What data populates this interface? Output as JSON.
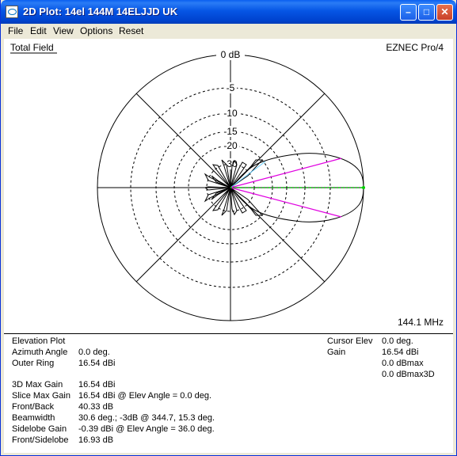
{
  "window": {
    "title": "2D Plot: 14el 144M  14ELJJD UK"
  },
  "menu": [
    "File",
    "Edit",
    "View",
    "Options",
    "Reset"
  ],
  "plot": {
    "field_label": "Total Field",
    "program_label": "EZNEC Pro/4",
    "frequency": "144.1 MHz",
    "ring_labels": [
      "0 dB",
      "-5",
      "-10",
      "-15",
      "-20",
      "-30"
    ],
    "colors": {
      "pattern": "#000000",
      "gain_marker": "#00CC00",
      "beamwidth_lines": "#E000E0",
      "sidelobe_line": "#66CCFF"
    }
  },
  "info": {
    "plot_type": "Elevation Plot",
    "rows_left": [
      {
        "label": "Azimuth Angle",
        "value": "0.0 deg."
      },
      {
        "label": "Outer Ring",
        "value": "16.54 dBi"
      },
      {
        "label": "3D Max Gain",
        "value": "16.54 dBi"
      },
      {
        "label": "Slice Max Gain",
        "value": "16.54 dBi @ Elev Angle = 0.0 deg."
      },
      {
        "label": "Front/Back",
        "value": "40.33 dB"
      },
      {
        "label": "Beamwidth",
        "value": "30.6 deg.; -3dB @ 344.7, 15.3 deg."
      },
      {
        "label": "Sidelobe Gain",
        "value": "-0.39 dBi @ Elev Angle = 36.0 deg."
      },
      {
        "label": "Front/Sidelobe",
        "value": "16.93 dB"
      }
    ],
    "cursor": {
      "elev_label": "Cursor Elev",
      "elev_value": "0.0 deg.",
      "gain_label": "Gain",
      "gain_value": "16.54 dBi",
      "dbmax": "0.0 dBmax",
      "dbmax3d": "0.0 dBmax3D"
    }
  }
}
